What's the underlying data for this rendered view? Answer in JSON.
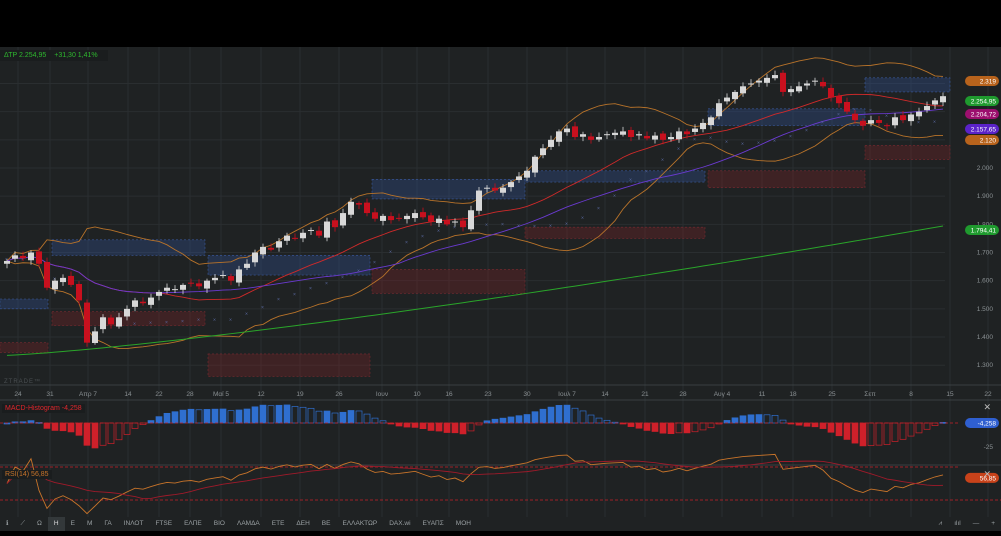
{
  "legend": {
    "symbol_price": "ΔΤΡ 2.254,95",
    "change": "+31,30 1,41%"
  },
  "watermark": "ZTRADE™",
  "chart_data": {
    "type": "candlestick",
    "symbol": "ΔΤΡ",
    "x_tick_labels": [
      "24",
      "31",
      "Απρ 7",
      "14",
      "22",
      "28",
      "Μαϊ 5",
      "12",
      "19",
      "26",
      "Ιουν",
      "10",
      "16",
      "23",
      "30",
      "Ιουλ 7",
      "14",
      "21",
      "28",
      "Αυγ 4",
      "11",
      "18",
      "25",
      "Σεπ",
      "8",
      "15",
      "22"
    ],
    "y_tick_labels": [
      "2.000",
      "1.900",
      "1.800",
      "1.700",
      "1.600",
      "1.500",
      "1.400",
      "1.300"
    ],
    "ylim": [
      1250,
      2380
    ],
    "closes": [
      1670,
      1690,
      1680,
      1700,
      1660,
      1575,
      1600,
      1610,
      1585,
      1530,
      1380,
      1420,
      1470,
      1445,
      1470,
      1500,
      1530,
      1520,
      1540,
      1560,
      1575,
      1570,
      1585,
      1590,
      1580,
      1600,
      1610,
      1620,
      1600,
      1640,
      1660,
      1700,
      1720,
      1710,
      1740,
      1760,
      1750,
      1770,
      1780,
      1760,
      1810,
      1790,
      1840,
      1880,
      1870,
      1840,
      1820,
      1830,
      1815,
      1820,
      1830,
      1840,
      1825,
      1810,
      1820,
      1800,
      1810,
      1790,
      1850,
      1920,
      1930,
      1920,
      1930,
      1950,
      1970,
      1990,
      2040,
      2070,
      2100,
      2130,
      2140,
      2110,
      2120,
      2100,
      2110,
      2120,
      2125,
      2130,
      2110,
      2120,
      2105,
      2115,
      2100,
      2110,
      2130,
      2120,
      2140,
      2160,
      2180,
      2230,
      2250,
      2270,
      2290,
      2300,
      2310,
      2320,
      2330,
      2270,
      2280,
      2290,
      2300,
      2310,
      2290,
      2250,
      2230,
      2200,
      2170,
      2150,
      2170,
      2160,
      2150,
      2180,
      2170,
      2190,
      2200,
      2220,
      2240,
      2254.95
    ],
    "price_labels": [
      {
        "value": "2.319",
        "color": "#b8631c"
      },
      {
        "value": "2.254,95",
        "color": "#1f9a2e"
      },
      {
        "value": "2.204,72",
        "color": "#9c0f6e"
      },
      {
        "value": "2.157,65",
        "color": "#5a22c8"
      },
      {
        "value": "2.120",
        "color": "#b8631c"
      },
      {
        "value": "1.794,41",
        "color": "#1f9a2e"
      }
    ],
    "macd": {
      "label": "MACD-Histogram -4,258",
      "value_label": "-4,258",
      "tick": "-25"
    },
    "rsi": {
      "label": "RSI(14) 56,85",
      "value_label": "56,85"
    }
  },
  "toolbar": {
    "items": [
      "Ω",
      "Η",
      "Ε",
      "Μ",
      "ΓΑ",
      "ΙΝΛΟΤ",
      "FTSE",
      "ΕΛΠΕ",
      "ΒΙΟ",
      "ΛΑΜΔΑ",
      "ΕΤΕ",
      "ΔΕΗ",
      "ΒΕ",
      "ΕΛΛΑΚΤΩΡ",
      "DAX.wi",
      "ΕΥΑΠΣ",
      "ΜΟΗ"
    ],
    "active": "Η"
  }
}
